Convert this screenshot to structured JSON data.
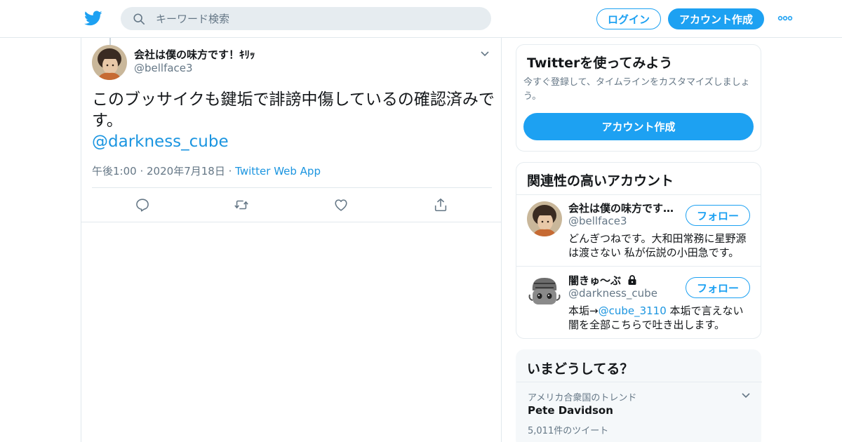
{
  "colors": {
    "brand": "#1da1f2",
    "link": "#1b95e0",
    "text_primary": "#14171a",
    "text_secondary": "#657786",
    "search_bg": "#e6ecf0"
  },
  "header": {
    "logo_icon": "twitter-bird-icon",
    "search_placeholder": "キーワード検索",
    "login_label": "ログイン",
    "signup_label": "アカウント作成",
    "more_icon": "more-dots-icon"
  },
  "tweet": {
    "author_name": "会社は僕の味方です！ｷﾘｯ",
    "author_handle": "@bellface3",
    "text": "このブッサイクも鍵垢で誹謗中傷しているの確認済みです。",
    "mention": "@darkness_cube",
    "time": "午後1:00",
    "date": "2020年7月18日",
    "app": "Twitter Web App",
    "actions": [
      "reply-icon",
      "retweet-icon",
      "like-icon",
      "share-icon"
    ]
  },
  "sidebar": {
    "signup_card": {
      "title": "Twitterを使ってみよう",
      "description": "今すぐ登録して、タイムラインをカスタマイズしましょう。",
      "button": "アカウント作成"
    },
    "related": {
      "title": "関連性の高いアカウント",
      "follow_label": "フォロー",
      "accounts": [
        {
          "name": "会社は僕の味方です！ｷﾘｯ",
          "handle": "@bellface3",
          "bio": "どんぎつねです。大和田常務に星野源は渡さない 私が伝説の小田急です。"
        },
        {
          "name": "闇きゅ〜ぶ",
          "handle": "@darkness_cube",
          "bio_prefix": "本垢→",
          "bio_link": "@cube_3110",
          "bio_suffix": " 本垢で言えない闇を全部こちらで吐き出します。"
        }
      ]
    },
    "trends": {
      "title": "いまどうしてる？",
      "location": "アメリカ合衆国のトレンド",
      "name": "Pete Davidson",
      "count": "5,011件のツイート"
    }
  }
}
